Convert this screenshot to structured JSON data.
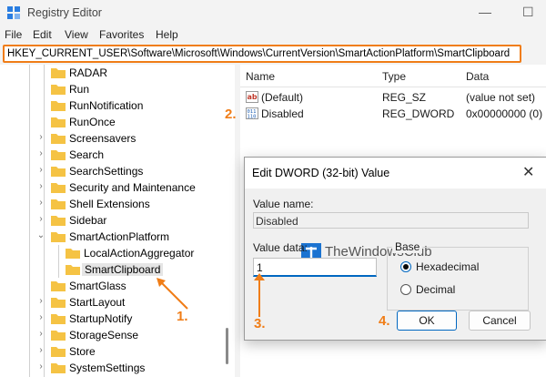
{
  "window": {
    "title": "Registry Editor",
    "minimize_glyph": "—",
    "maximize_glyph": "☐"
  },
  "menu": [
    "File",
    "Edit",
    "View",
    "Favorites",
    "Help"
  ],
  "address": "HKEY_CURRENT_USER\\Software\\Microsoft\\Windows\\CurrentVersion\\SmartActionPlatform\\SmartClipboard",
  "tree": {
    "items": [
      {
        "label": "RADAR",
        "chevron": ""
      },
      {
        "label": "Run",
        "chevron": ""
      },
      {
        "label": "RunNotification",
        "chevron": ""
      },
      {
        "label": "RunOnce",
        "chevron": ""
      },
      {
        "label": "Screensavers",
        "chevron": "›"
      },
      {
        "label": "Search",
        "chevron": "›"
      },
      {
        "label": "SearchSettings",
        "chevron": "›"
      },
      {
        "label": "Security and Maintenance",
        "chevron": "›"
      },
      {
        "label": "Shell Extensions",
        "chevron": "›"
      },
      {
        "label": "Sidebar",
        "chevron": "›"
      },
      {
        "label": "SmartActionPlatform",
        "chevron": "⌄"
      },
      {
        "label": "LocalActionAggregator",
        "chevron": ""
      },
      {
        "label": "SmartClipboard",
        "chevron": ""
      },
      {
        "label": "SmartGlass",
        "chevron": ""
      },
      {
        "label": "StartLayout",
        "chevron": "›"
      },
      {
        "label": "StartupNotify",
        "chevron": "›"
      },
      {
        "label": "StorageSense",
        "chevron": "›"
      },
      {
        "label": "Store",
        "chevron": "›"
      },
      {
        "label": "SystemSettings",
        "chevron": "›"
      }
    ]
  },
  "list": {
    "columns": {
      "name": "Name",
      "type": "Type",
      "data": "Data"
    },
    "rows": [
      {
        "name": "(Default)",
        "type": "REG_SZ",
        "data": "(value not set)",
        "icon": "string-value-icon"
      },
      {
        "name": "Disabled",
        "type": "REG_DWORD",
        "data": "0x00000000 (0)",
        "icon": "binary-value-icon"
      }
    ]
  },
  "dialog": {
    "title": "Edit DWORD (32-bit) Value",
    "close_glyph": "✕",
    "value_name_label": "Value name:",
    "value_name": "Disabled",
    "value_data_label": "Value data:",
    "value_data": "1",
    "base_label": "Base",
    "hex_label": "Hexadecimal",
    "dec_label": "Decimal",
    "ok_label": "OK",
    "cancel_label": "Cancel"
  },
  "watermark": "TheWindowsClub",
  "steps": {
    "s1": "1.",
    "s2": "2.",
    "s3": "3.",
    "s4": "4."
  },
  "colors": {
    "accent": "#f07d17",
    "folder": "#f5c344",
    "focus": "#0067c0"
  }
}
